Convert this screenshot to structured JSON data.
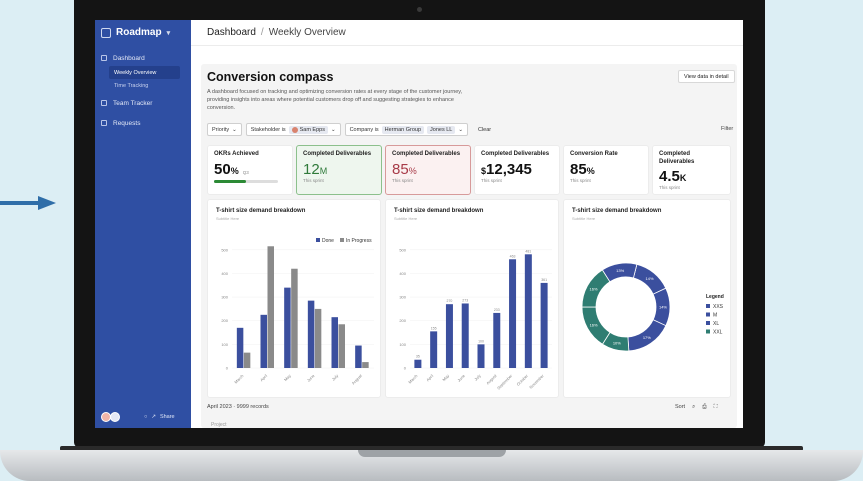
{
  "app": {
    "brand": "Roadmap",
    "nav": [
      {
        "label": "Dashboard"
      },
      {
        "label": "Team Tracker"
      },
      {
        "label": "Requests"
      }
    ],
    "sub_nav": [
      {
        "label": "Weekly Overview",
        "active": true
      },
      {
        "label": "Time Tracking",
        "active": false
      }
    ],
    "share_label": "Share"
  },
  "breadcrumb": {
    "root": "Dashboard",
    "sep": "/",
    "current": "Weekly Overview"
  },
  "page": {
    "title": "Conversion compass",
    "description": "A dashboard focused on tracking and optimizing conversion rates at every stage of the customer journey, providing insights into areas where potential customers drop off and suggesting strategies to enhance conversion.",
    "view_detail_label": "View data in detail"
  },
  "filters": {
    "priority": "Priority",
    "stakeholder_label": "Stakeholder is",
    "stakeholder_value": "Sam Epps",
    "company_label": "Company is",
    "company_values": [
      "Herman Group",
      "Jones LL"
    ],
    "clear": "Clear",
    "filter": "Filter"
  },
  "kpis": [
    {
      "label": "OKRs Achieved",
      "value": "50",
      "unit": "%",
      "extra": "Q3",
      "progress": 0.5
    },
    {
      "label": "Completed Deliverables",
      "value": "12",
      "unit": "M",
      "sub": "This sprint"
    },
    {
      "label": "Completed Deliverables",
      "value": "85",
      "unit": "%",
      "sub": "This sprint"
    },
    {
      "label": "Completed Deliverables",
      "value": "12,345",
      "prefix": "$",
      "sub": "This sprint"
    },
    {
      "label": "Conversion Rate",
      "value": "85",
      "unit": "%",
      "sub": "This sprint"
    },
    {
      "label": "Completed Deliverables",
      "value": "4.5",
      "unit": "K",
      "sub": "This sprint"
    }
  ],
  "colors": {
    "sidebar": "#2f4fa3",
    "blue": "#3b4f9e",
    "gray": "#8a8a8a",
    "teal": "#2f7d72",
    "green": "#2c8a35"
  },
  "table": {
    "month": "April 2023",
    "records": "9999 records",
    "sort": "Sort",
    "first_col": "Project"
  },
  "chart_data": [
    {
      "type": "bar",
      "title": "T-shirt size demand breakdown",
      "subtitle": "Subtitle Here",
      "categories": [
        "March",
        "April",
        "May",
        "June",
        "July",
        "August"
      ],
      "series": [
        {
          "name": "Done",
          "values": [
            170,
            225,
            340,
            285,
            215,
            95
          ],
          "color": "#3b4f9e"
        },
        {
          "name": "In Progress",
          "values": [
            65,
            515,
            420,
            250,
            185,
            25
          ],
          "color": "#8a8a8a"
        }
      ],
      "ylim": [
        0,
        550
      ],
      "yticks": [
        0,
        100,
        200,
        300,
        400,
        500
      ]
    },
    {
      "type": "bar",
      "title": "T-shirt size demand breakdown",
      "subtitle": "Subtitle Here",
      "categories": [
        "March",
        "April",
        "May",
        "June",
        "July",
        "August",
        "September",
        "October",
        "November"
      ],
      "values": [
        35,
        155,
        270,
        273,
        100,
        233,
        460,
        160,
        360
      ],
      "data_labels": [
        "35",
        "155",
        "270",
        "273",
        "100",
        "233",
        "463",
        "160",
        "361"
      ],
      "extra_tall": {
        "index": 7,
        "value": 481,
        "label": "481"
      },
      "ylim": [
        0,
        550
      ],
      "yticks": [
        0,
        100,
        200,
        300,
        400,
        500
      ]
    },
    {
      "type": "pie",
      "title": "T-shirt size demand breakdown",
      "subtitle": "Subtitle Here",
      "legend_title": "Legend",
      "legend": [
        {
          "name": "XXS",
          "color": "#3b4f9e"
        },
        {
          "name": "M",
          "color": "#3b4f9e"
        },
        {
          "name": "XL",
          "color": "#3b4f9e"
        },
        {
          "name": "XXL",
          "color": "#2f7d72"
        }
      ],
      "slices": [
        {
          "label": "14%",
          "value": 14,
          "color": "#3b4f9e"
        },
        {
          "label": "14%",
          "value": 14,
          "color": "#3b4f9e"
        },
        {
          "label": "17%",
          "value": 17,
          "color": "#3b4f9e"
        },
        {
          "label": "10%",
          "value": 10,
          "color": "#2f7d72"
        },
        {
          "label": "16%",
          "value": 16,
          "color": "#2f7d72"
        },
        {
          "label": "16%",
          "value": 16,
          "color": "#2f7d72"
        },
        {
          "label": "13%",
          "value": 13,
          "color": "#3b4f9e"
        }
      ]
    }
  ]
}
